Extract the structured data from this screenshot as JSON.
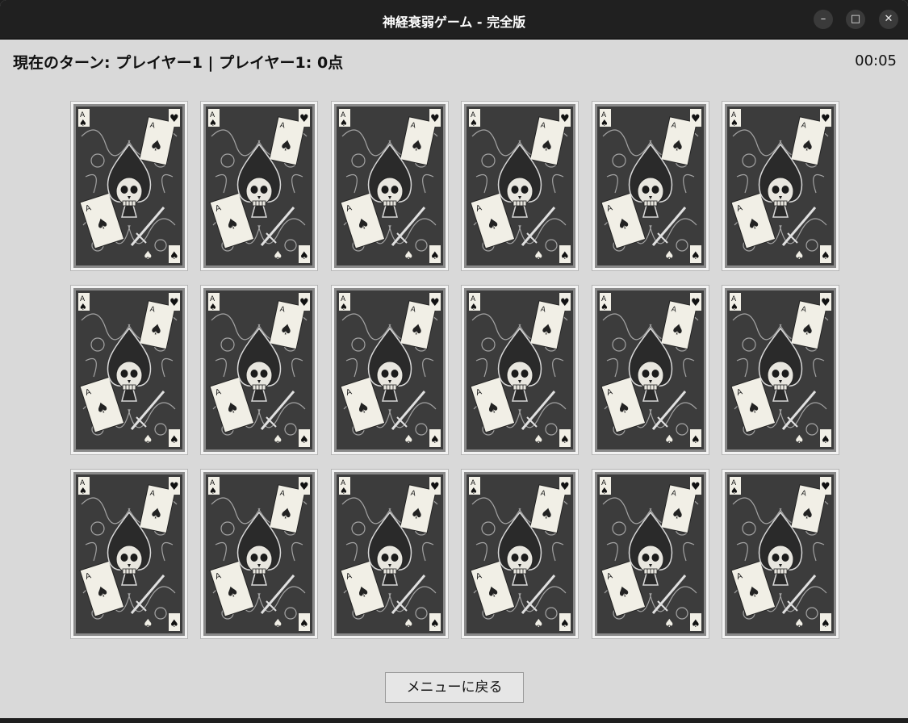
{
  "window": {
    "title": "神経衰弱ゲーム - 完全版",
    "controls": {
      "minimize": "–",
      "maximize": "□",
      "close": "✕"
    }
  },
  "game": {
    "status": "現在のターン: プレイヤー1 | プレイヤー1: 0点",
    "timer": "00:05",
    "card_back": {
      "style": "skull-and-spade ornate card back",
      "corner_suit_left": "♠",
      "corner_suit_right": "♥",
      "ace_rank": "A",
      "colors": {
        "frame": "#3c3c3c",
        "face": "#f1efe6",
        "ink": "#222222"
      }
    },
    "cards": [
      {
        "state": "face-down"
      },
      {
        "state": "face-down"
      },
      {
        "state": "face-down"
      },
      {
        "state": "face-down"
      },
      {
        "state": "face-down"
      },
      {
        "state": "face-down"
      },
      {
        "state": "face-down"
      },
      {
        "state": "face-down"
      },
      {
        "state": "face-down"
      },
      {
        "state": "face-down"
      },
      {
        "state": "face-down"
      },
      {
        "state": "face-down"
      },
      {
        "state": "face-down"
      },
      {
        "state": "face-down"
      },
      {
        "state": "face-down"
      },
      {
        "state": "face-down"
      },
      {
        "state": "face-down"
      },
      {
        "state": "face-down"
      }
    ]
  },
  "footer": {
    "menu_button": "メニューに戻る"
  }
}
